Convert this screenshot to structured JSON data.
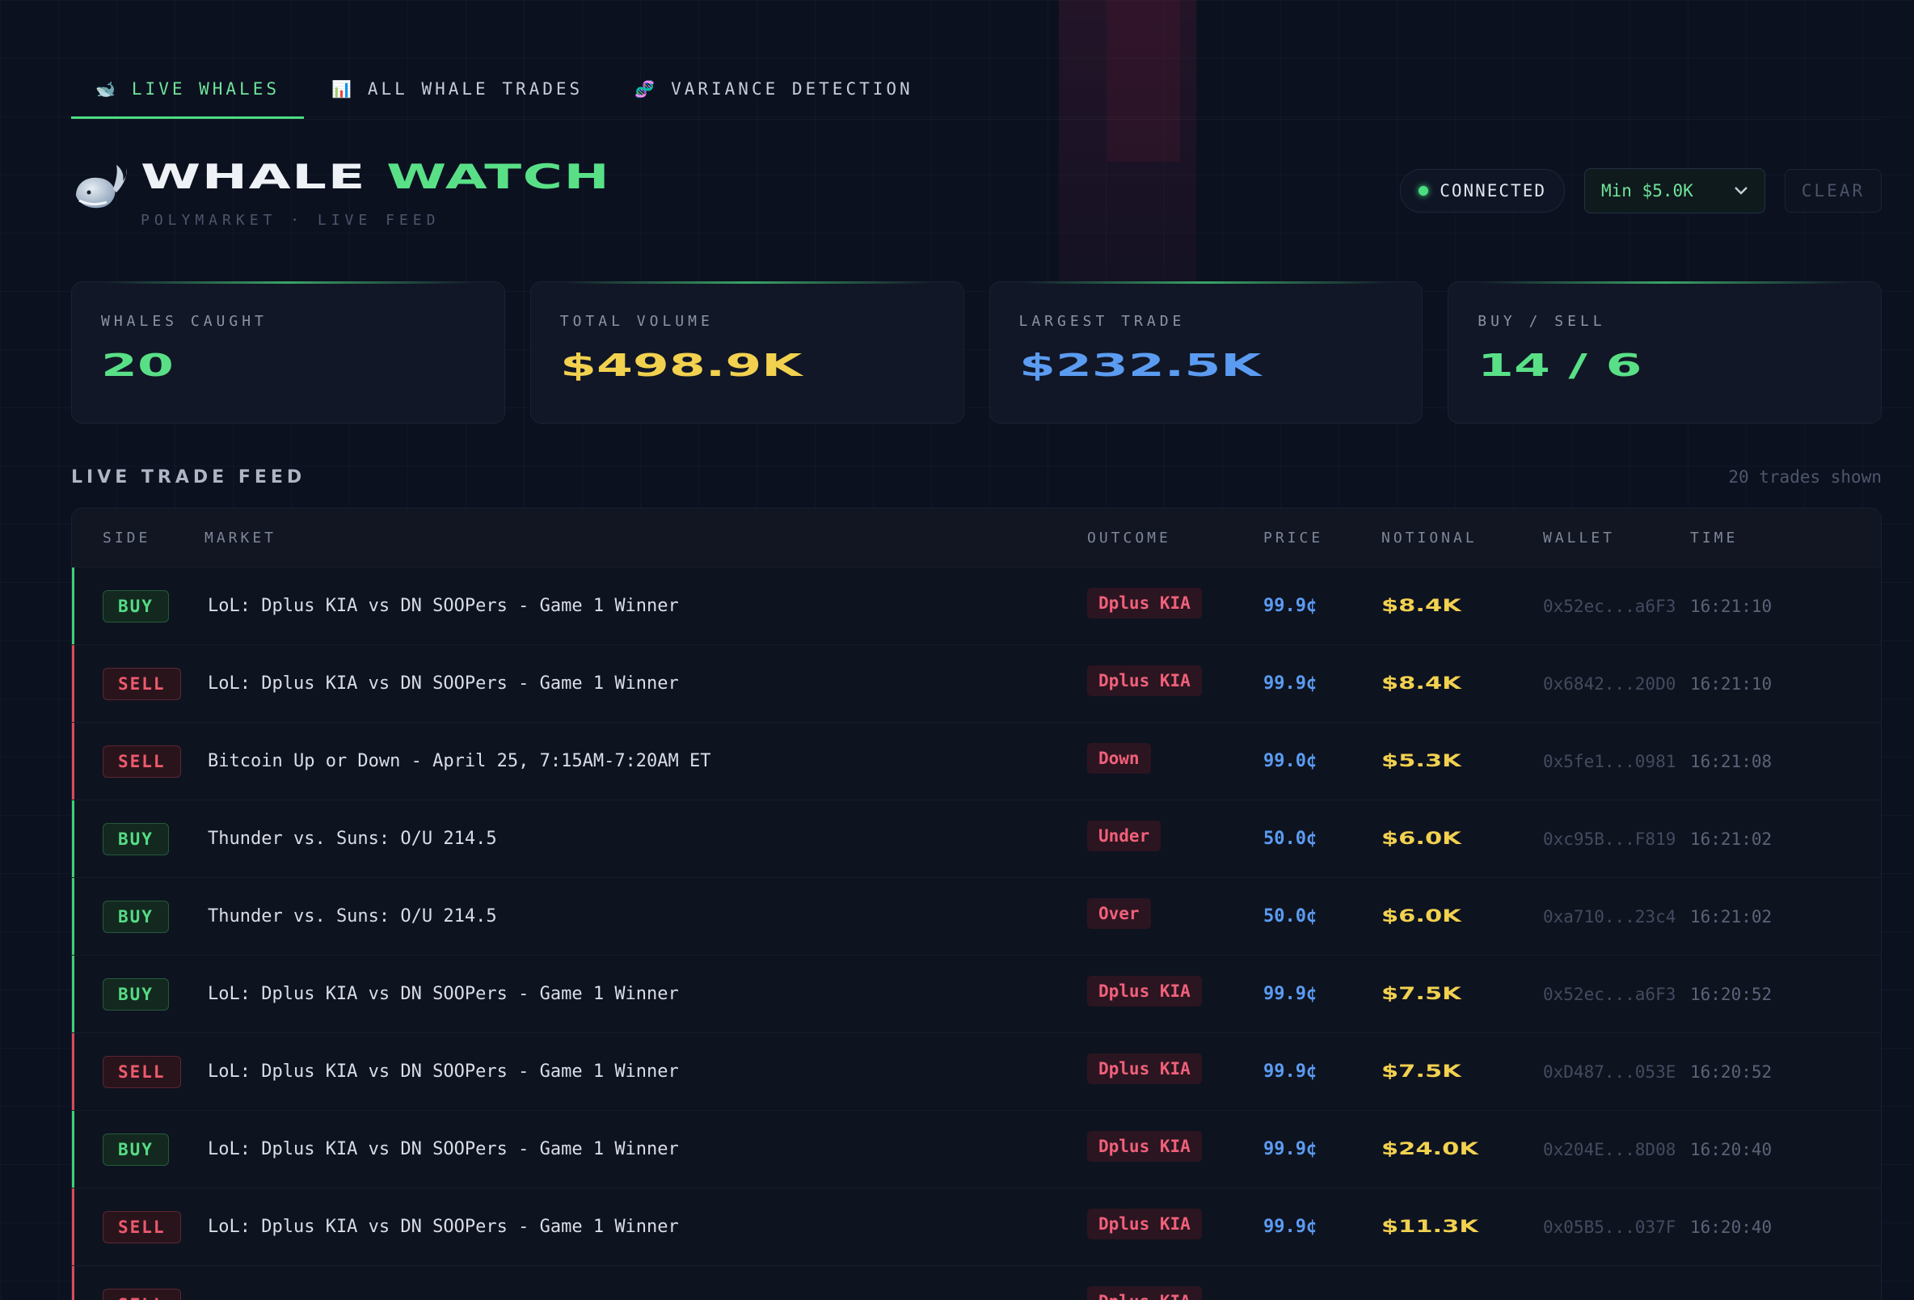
{
  "tabs": [
    {
      "icon": "🐋",
      "label": "LIVE WHALES",
      "active": true
    },
    {
      "icon": "📊",
      "label": "ALL WHALE TRADES",
      "active": false
    },
    {
      "icon": "🧬",
      "label": "VARIANCE DETECTION",
      "active": false
    }
  ],
  "header": {
    "brand_part1": "WHALE",
    "brand_part2": "WATCH",
    "subtitle": "POLYMARKET · LIVE FEED",
    "status": "CONNECTED",
    "min_filter": "Min $5.0K",
    "clear_label": "CLEAR"
  },
  "stats": [
    {
      "label": "WHALES CAUGHT",
      "value": "20",
      "color": "#59e087"
    },
    {
      "label": "TOTAL VOLUME",
      "value": "$498.9K",
      "color": "#f2d14f"
    },
    {
      "label": "LARGEST TRADE",
      "value": "$232.5K",
      "color": "#5b9cf2"
    },
    {
      "label": "BUY / SELL",
      "value": "14 / 6",
      "color": "#59e087"
    }
  ],
  "feed": {
    "title": "LIVE TRADE FEED",
    "count": "20 trades shown",
    "columns": [
      "SIDE",
      "MARKET",
      "OUTCOME",
      "PRICE",
      "NOTIONAL",
      "WALLET",
      "TIME"
    ],
    "rows": [
      {
        "side": "BUY",
        "market": "LoL: Dplus KIA vs DN SOOPers - Game 1 Winner",
        "outcome": "Dplus KIA",
        "price": "99.9¢",
        "notional": "$8.4K",
        "wallet": "0x52ec...a6F3",
        "time": "16:21:10"
      },
      {
        "side": "SELL",
        "market": "LoL: Dplus KIA vs DN SOOPers - Game 1 Winner",
        "outcome": "Dplus KIA",
        "price": "99.9¢",
        "notional": "$8.4K",
        "wallet": "0x6842...20D0",
        "time": "16:21:10"
      },
      {
        "side": "SELL",
        "market": "Bitcoin Up or Down - April 25, 7:15AM-7:20AM ET",
        "outcome": "Down",
        "price": "99.0¢",
        "notional": "$5.3K",
        "wallet": "0x5fe1...0981",
        "time": "16:21:08"
      },
      {
        "side": "BUY",
        "market": "Thunder vs. Suns: O/U 214.5",
        "outcome": "Under",
        "price": "50.0¢",
        "notional": "$6.0K",
        "wallet": "0xc95B...F819",
        "time": "16:21:02"
      },
      {
        "side": "BUY",
        "market": "Thunder vs. Suns: O/U 214.5",
        "outcome": "Over",
        "price": "50.0¢",
        "notional": "$6.0K",
        "wallet": "0xa710...23c4",
        "time": "16:21:02"
      },
      {
        "side": "BUY",
        "market": "LoL: Dplus KIA vs DN SOOPers - Game 1 Winner",
        "outcome": "Dplus KIA",
        "price": "99.9¢",
        "notional": "$7.5K",
        "wallet": "0x52ec...a6F3",
        "time": "16:20:52"
      },
      {
        "side": "SELL",
        "market": "LoL: Dplus KIA vs DN SOOPers - Game 1 Winner",
        "outcome": "Dplus KIA",
        "price": "99.9¢",
        "notional": "$7.5K",
        "wallet": "0xD487...053E",
        "time": "16:20:52"
      },
      {
        "side": "BUY",
        "market": "LoL: Dplus KIA vs DN SOOPers - Game 1 Winner",
        "outcome": "Dplus KIA",
        "price": "99.9¢",
        "notional": "$24.0K",
        "wallet": "0x204E...8D08",
        "time": "16:20:40"
      },
      {
        "side": "SELL",
        "market": "LoL: Dplus KIA vs DN SOOPers - Game 1 Winner",
        "outcome": "Dplus KIA",
        "price": "99.9¢",
        "notional": "$11.3K",
        "wallet": "0x05B5...037F",
        "time": "16:20:40"
      },
      {
        "side": "SELL",
        "market": "",
        "outcome": "Dplus KIA",
        "price": "",
        "notional": "",
        "wallet": "",
        "time": ""
      }
    ]
  }
}
